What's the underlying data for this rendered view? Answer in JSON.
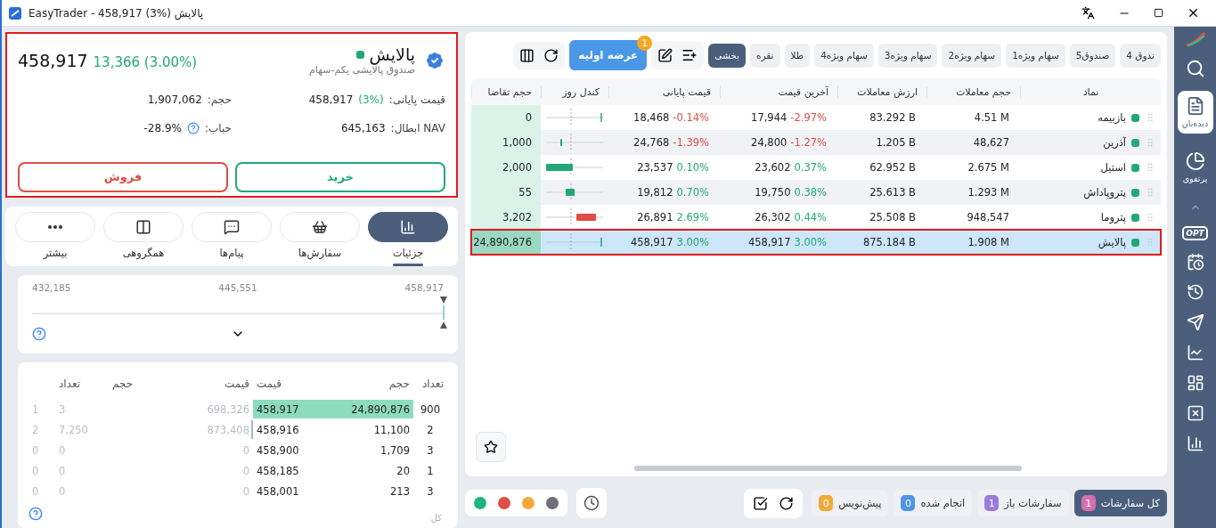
{
  "title_bar": {
    "title": "EasyTrader - 458,917 (3%) پالایش"
  },
  "symbol_card": {
    "highlighted": true,
    "name": "پالایش",
    "subtitle": "صندوق پالایشی یکم-سهام",
    "price": "458,917",
    "change": "13,366 (3.00%)",
    "stats": [
      {
        "label": "قیمت پایانی:",
        "value": "458,917",
        "change": "(3%)",
        "help": false
      },
      {
        "label": "حجم:",
        "value": "1,907,062",
        "help": false
      },
      {
        "label": "NAV ابطال:",
        "value": "645,163",
        "help": false
      },
      {
        "label": "حباب:",
        "value": "-28.9%",
        "help": true
      }
    ],
    "buttons": [
      {
        "kind": "buy",
        "label": "خرید"
      },
      {
        "kind": "sell",
        "label": "فروش"
      }
    ]
  },
  "detail_tabs": [
    {
      "kind": "chart",
      "label": "جزئیات",
      "selected": true
    },
    {
      "kind": "basket",
      "label": "سفارش‌ها",
      "selected": false
    },
    {
      "kind": "chat",
      "label": "پیام‌ها",
      "selected": false
    },
    {
      "kind": "columns",
      "label": "همگروهی",
      "selected": false
    },
    {
      "kind": "more",
      "label": "بیشتر",
      "selected": false
    }
  ],
  "price_range": {
    "labels": [
      "458,917",
      "445,551",
      "432,185"
    ],
    "level": 1
  },
  "order_book": {
    "headers": [
      "تعداد",
      "حجم",
      "قیمت",
      "قیمت",
      "حجم",
      "تعداد"
    ],
    "rows": [
      {
        "buy": {
          "count": "900",
          "volume": "24,890,876",
          "price": "458,917"
        },
        "sell": {
          "price": "698,326",
          "volume": "3",
          "count": "1"
        }
      },
      {
        "buy": {
          "count": "2",
          "volume": "11,100",
          "price": "458,916"
        },
        "sell": {
          "price": "873,408",
          "volume": "7,250",
          "count": "2"
        }
      },
      {
        "buy": {
          "count": "3",
          "volume": "1,709",
          "price": "458,900"
        },
        "sell": {
          "price": "0",
          "volume": "0",
          "count": "0"
        }
      },
      {
        "buy": {
          "count": "1",
          "volume": "20",
          "price": "458,185"
        },
        "sell": {
          "price": "0",
          "volume": "0",
          "count": "0"
        }
      },
      {
        "buy": {
          "count": "3",
          "volume": "213",
          "price": "458,001"
        },
        "sell": {
          "price": "0",
          "volume": "0",
          "count": "0"
        }
      }
    ],
    "footer": "کل"
  },
  "watch_tabs": [
    {
      "label": "ندوق 4",
      "selected": false
    },
    {
      "label": "صندوق5",
      "selected": false
    },
    {
      "label": "سهام ویژه1",
      "selected": false
    },
    {
      "label": "سهام ویژه2",
      "selected": false
    },
    {
      "label": "سهام ویژه3",
      "selected": false
    },
    {
      "label": "سهام ویژه4",
      "selected": false
    },
    {
      "label": "طلا",
      "selected": false
    },
    {
      "label": "نقره",
      "selected": false
    },
    {
      "label": "بخشی",
      "selected": true
    }
  ],
  "ipo_button": {
    "label": "عرضه اولیه",
    "badge": "1"
  },
  "table": {
    "columns": [
      "نماد",
      "حجم معاملات",
      "ارزش معاملات",
      "آخرین قیمت",
      "قیمت پایانی",
      "کندل روز",
      "حجم تقاضا"
    ],
    "rows": [
      {
        "symbol": "بازبیمه",
        "volume": "4.51 M",
        "value": "83.292 B",
        "last": {
          "value": "17,944",
          "change": "-2.97%",
          "color": "#dc4d45"
        },
        "close": {
          "value": "18,468",
          "change": "-0.14%",
          "color": "#dc4d45"
        },
        "demand": "0",
        "selected": false
      },
      {
        "symbol": "آذرین",
        "volume": "48,627",
        "value": "1.205 B",
        "last": {
          "value": "24,800",
          "change": "-1.27%",
          "color": "#dc4d45"
        },
        "close": {
          "value": "24,768",
          "change": "-1.39%",
          "color": "#dc4d45"
        },
        "demand": "1,000",
        "selected": false
      },
      {
        "symbol": "استیل",
        "volume": "2.675 M",
        "value": "62.952 B",
        "last": {
          "value": "23,602",
          "change": "0.37%",
          "color": "#22a874"
        },
        "close": {
          "value": "23,537",
          "change": "0.10%",
          "color": "#22a874"
        },
        "demand": "2,000",
        "selected": false
      },
      {
        "symbol": "پتروپاداش",
        "volume": "1.293 M",
        "value": "25.613 B",
        "last": {
          "value": "19,750",
          "change": "0.38%",
          "color": "#22a874"
        },
        "close": {
          "value": "19,812",
          "change": "0.70%",
          "color": "#22a874"
        },
        "demand": "55",
        "selected": false
      },
      {
        "symbol": "پتروما",
        "volume": "948,547",
        "value": "25.508 B",
        "last": {
          "value": "26,302",
          "change": "0.44%",
          "color": "#22a874"
        },
        "close": {
          "value": "26,891",
          "change": "2.69%",
          "color": "#22a874"
        },
        "demand": "3,202",
        "selected": false
      },
      {
        "symbol": "پالایش",
        "volume": "1.908 M",
        "value": "875.184 B",
        "last": {
          "value": "458,917",
          "change": "3.00%",
          "color": "#22a874"
        },
        "close": {
          "value": "458,917",
          "change": "3.00%",
          "color": "#22a874"
        },
        "demand": "24,890,876",
        "selected": true
      }
    ]
  },
  "order_tabs": [
    {
      "label": "کل سفارشات",
      "count": "1",
      "color": "#d56fae",
      "selected": true
    },
    {
      "label": "سفارشات باز",
      "count": "1",
      "color": "#9a7be0",
      "selected": false
    },
    {
      "label": "انجام شده",
      "count": "0",
      "color": "#4e95e6",
      "selected": false
    },
    {
      "label": "پیش‌نویس",
      "count": "0",
      "color": "#f2a93b",
      "selected": false
    }
  ],
  "status_dots": [
    {
      "color": "#1fb57d"
    },
    {
      "color": "#df4f45"
    },
    {
      "color": "#f5a83a"
    },
    {
      "color": "#6c6f78"
    }
  ],
  "sidebar": {
    "items": [
      {
        "label": "دیده‌بان",
        "selected": true
      },
      {
        "label": "پرتفوی",
        "selected": false
      }
    ],
    "opt_label": "OPT"
  }
}
